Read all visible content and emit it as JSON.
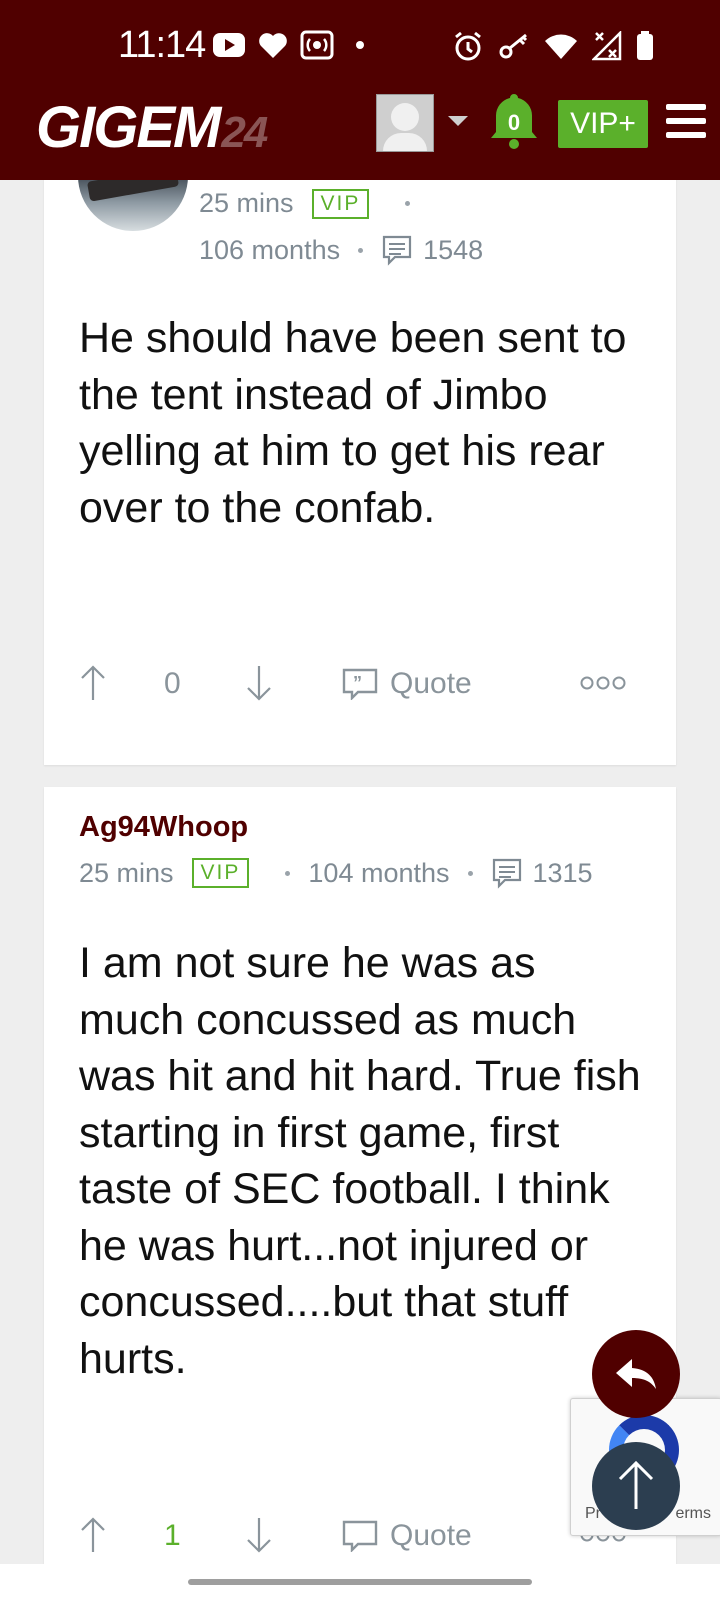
{
  "status_bar": {
    "time": "11:14"
  },
  "site": {
    "logo_main": "GIGEM",
    "logo_num": "24",
    "notification_count": "0",
    "vip_button": "VIP+"
  },
  "comments": [
    {
      "username": "",
      "time_ago": "25 mins",
      "badge": "VIP",
      "tenure": "106 months",
      "post_count": "1548",
      "body": "He should have been sent to the tent instead of Jimbo yelling at him to get his rear over to the confab.",
      "votes": "0",
      "quote_label": "Quote"
    },
    {
      "username": "Ag94Whoop",
      "time_ago": "25 mins",
      "badge": "VIP",
      "tenure": "104 months",
      "post_count": "1315",
      "body": "I am not sure he was as much concussed as much was hit and hit hard. True fish starting in first game, first taste of SEC football. I think he was hurt...not injured or concussed....but that stuff hurts.",
      "votes": "1",
      "quote_label": "Quote"
    }
  ],
  "recaptcha": {
    "privacy": "Pr",
    "terms": "erms"
  },
  "colors": {
    "maroon": "#500000",
    "green": "#5bb02b",
    "meta_gray": "#7f8a93",
    "scroll_top": "#2c3e50"
  }
}
